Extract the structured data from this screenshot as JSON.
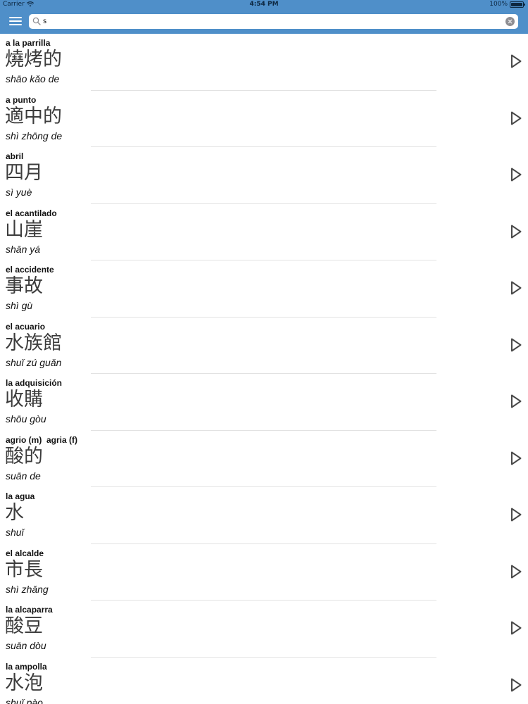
{
  "status_bar": {
    "carrier": "Carrier",
    "time": "4:54 PM",
    "battery": "100%",
    "wifi_icon": "wifi-icon",
    "battery_icon": "battery-icon"
  },
  "toolbar": {
    "menu_icon": "hamburger-menu-icon",
    "search": {
      "value": "s",
      "icon": "search-icon",
      "clear_icon": "clear-icon"
    }
  },
  "colors": {
    "header_background": "#4f8fc9",
    "chinese_text": "#3c3c3c",
    "divider": "#e2e2e2"
  },
  "entries": [
    {
      "spanish": "a la parrilla",
      "chinese": "燒烤的",
      "pinyin": "shāo kǎo de"
    },
    {
      "spanish": "a punto",
      "chinese": "適中的",
      "pinyin": "shì zhōng de"
    },
    {
      "spanish": "abril",
      "chinese": "四月",
      "pinyin": "sì yuè"
    },
    {
      "spanish": "el acantilado",
      "chinese": "山崖",
      "pinyin": "shān yá"
    },
    {
      "spanish": "el accidente",
      "chinese": "事故",
      "pinyin": "shì gù"
    },
    {
      "spanish": "el acuario",
      "chinese": "水族館",
      "pinyin": "shuǐ zú guǎn"
    },
    {
      "spanish": "la adquisición",
      "chinese": "收購",
      "pinyin": "shōu gòu"
    },
    {
      "spanish": "agrio (m)  agria (f)",
      "chinese": "酸的",
      "pinyin": "suān de"
    },
    {
      "spanish": "la agua",
      "chinese": "水",
      "pinyin": "shuǐ"
    },
    {
      "spanish": "el alcalde",
      "chinese": "市長",
      "pinyin": "shì zhǎng"
    },
    {
      "spanish": "la alcaparra",
      "chinese": "酸豆",
      "pinyin": "suān dòu"
    },
    {
      "spanish": "la ampolla",
      "chinese": "水泡",
      "pinyin": "shuǐ pào"
    }
  ]
}
